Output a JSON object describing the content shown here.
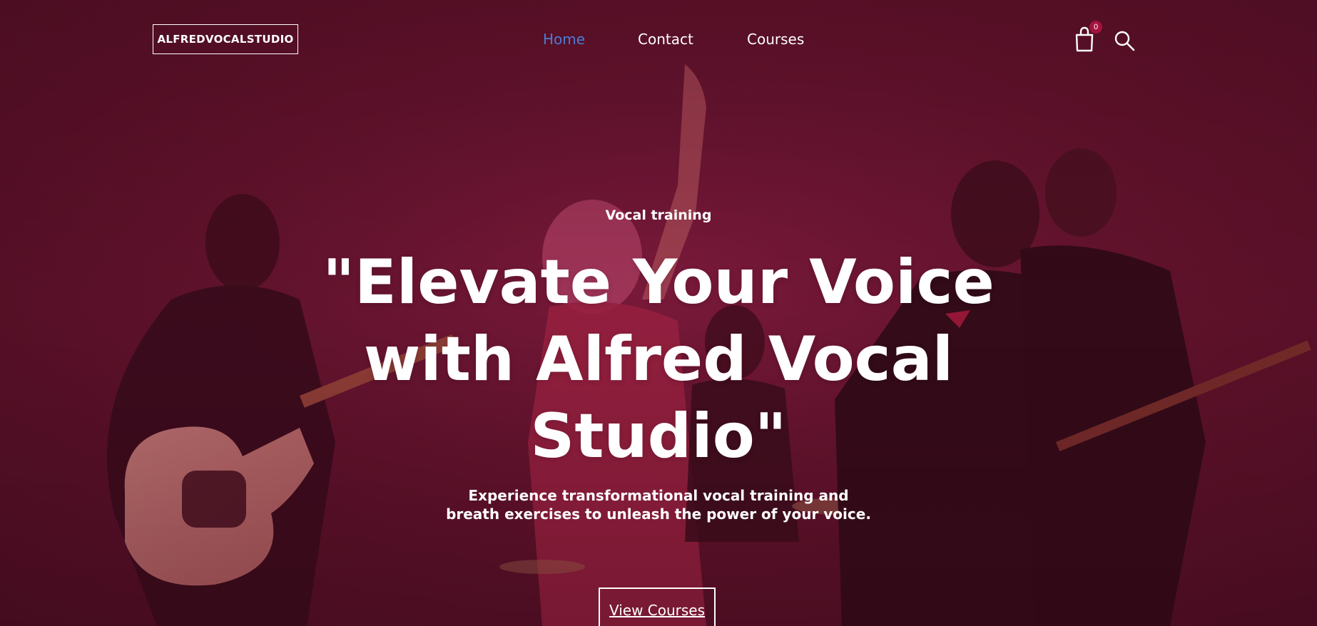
{
  "header": {
    "logo_text": "ALFREDVOCALSTUDIO",
    "nav": {
      "home": "Home",
      "contact": "Contact",
      "courses": "Courses"
    },
    "cart_count": "0",
    "icons": {
      "cart": "shopping-bag-icon",
      "search": "search-icon"
    }
  },
  "hero": {
    "eyebrow": "Vocal training",
    "headline": "\"Elevate Your Voice with Alfred Vocal Studio\"",
    "subtext": "Experience transformational vocal training and breath exercises to unleash the power of your voice.",
    "cta_label": "View Courses",
    "background_description_colors": {
      "base": "#5c1228",
      "accent": "#a4123f",
      "nav_active": "#4b7bd6"
    }
  }
}
